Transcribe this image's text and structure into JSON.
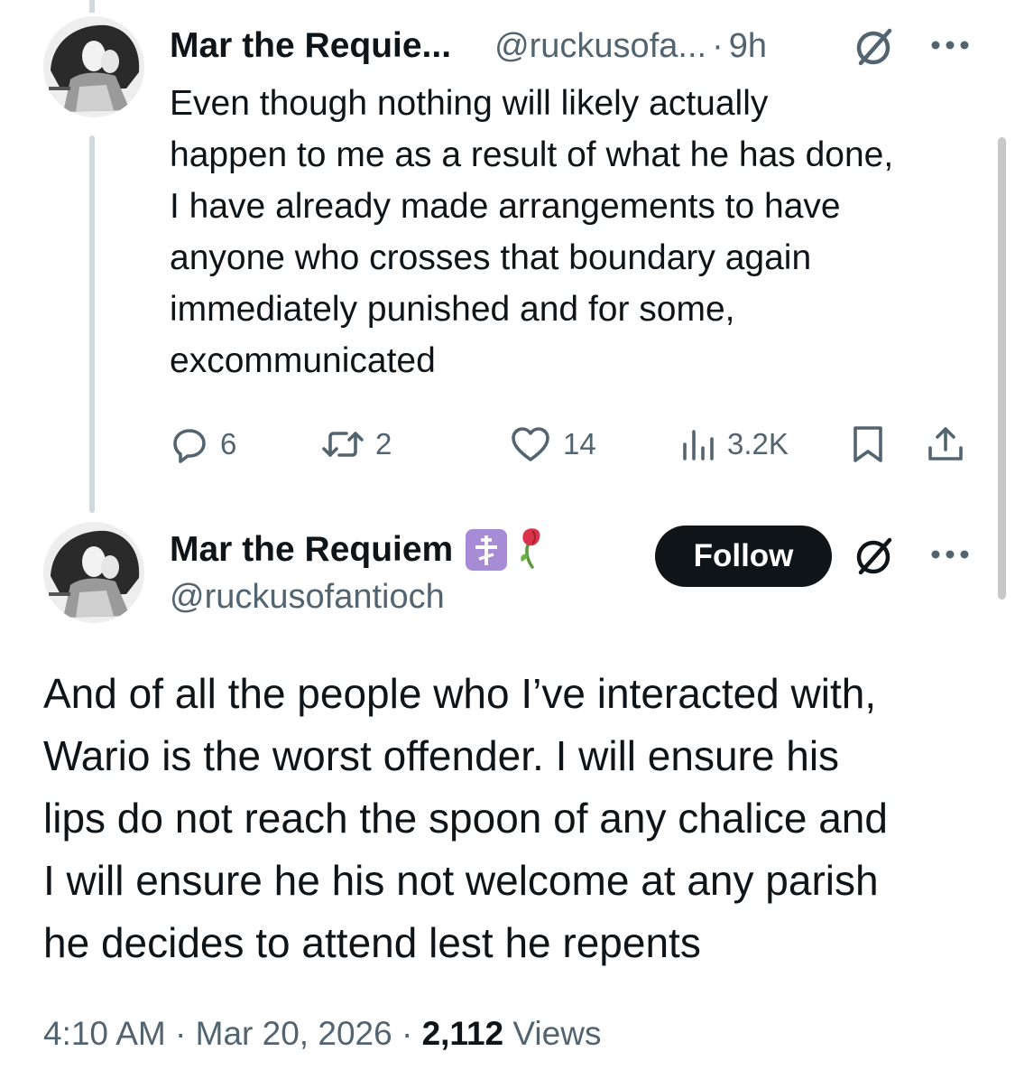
{
  "parent_tweet": {
    "display_name": "Mar the Requie...",
    "handle": "@ruckusofa...",
    "separator": "·",
    "time": "9h",
    "text_lines": [
      "Even though nothing will likely actually",
      "happen to me as a result of what he has done,",
      "I have already made arrangements to have",
      "anyone who crosses that boundary again",
      "immediately punished and for some,",
      "excommunicated"
    ],
    "replies": "6",
    "reposts": "2",
    "likes": "14",
    "views": "3.2K"
  },
  "main_tweet": {
    "display_name": "Mar the Requiem",
    "handle": "@ruckusofantioch",
    "follow_label": "Follow",
    "text_lines": [
      "And of all the people who I’ve interacted with,",
      "Wario is the worst offender. I will ensure his",
      "lips do not reach the spoon of any chalice and",
      "I will ensure he his not welcome at any parish",
      "he decides to attend lest he repents"
    ],
    "time": "4:10 AM",
    "sep1": " · ",
    "date": "Mar 20, 2026",
    "sep2": " · ",
    "views_count": "2,112",
    "views_label": " Views"
  },
  "icons": {
    "reply": "reply-icon",
    "repost": "repost-icon",
    "like": "heart-icon",
    "views": "views-chart-icon",
    "bookmark": "bookmark-icon",
    "share": "share-icon",
    "grok": "grok-icon",
    "more": "more-icon",
    "badge": "orthodox-cross-badge-icon",
    "emoji": "wilted-rose-icon"
  },
  "colors": {
    "text": "#0f1419",
    "secondary": "#536471",
    "follow_bg": "#0f1419",
    "thread_line": "#cfd9de",
    "badge": "#a88bd6"
  }
}
